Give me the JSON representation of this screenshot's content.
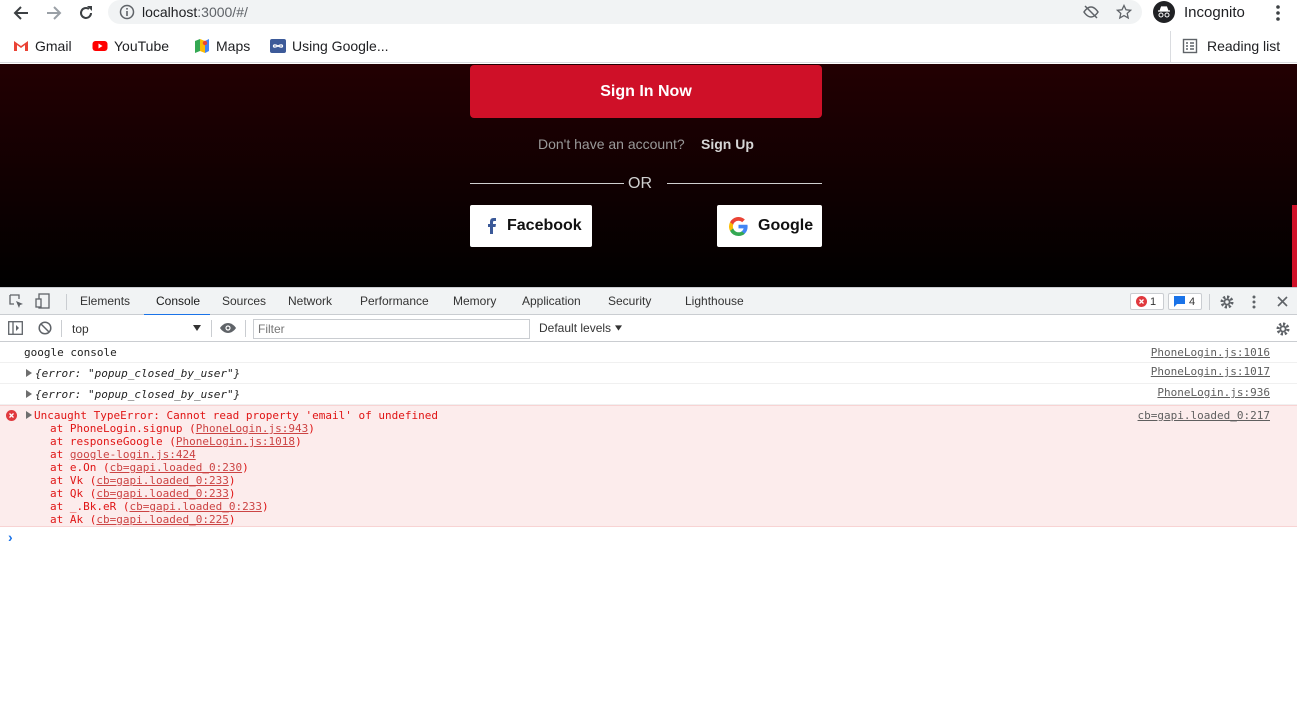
{
  "browser": {
    "url_host": "localhost",
    "url_rest": ":3000/#/",
    "profile_label": "Incognito",
    "bookmarks": [
      "Gmail",
      "YouTube",
      "Maps",
      "Using Google..."
    ],
    "reading_list": "Reading list"
  },
  "page": {
    "signin_label": "Sign In Now",
    "no_account_text": "Don't have an account?",
    "signup_label": "Sign Up",
    "or_text": "OR",
    "facebook_label": "Facebook",
    "google_label": "Google",
    "accent_color": "#cf1028"
  },
  "devtools": {
    "tabs": [
      "Elements",
      "Console",
      "Sources",
      "Network",
      "Performance",
      "Memory",
      "Application",
      "Security",
      "Lighthouse"
    ],
    "active_tab": "Console",
    "error_count": "1",
    "message_count": "4",
    "context": "top",
    "filter_placeholder": "Filter",
    "levels": "Default levels",
    "logs": [
      {
        "text": "google console",
        "source": "PhoneLogin.js:1016"
      },
      {
        "text": "{error: \"popup_closed_by_user\"}",
        "source": "PhoneLogin.js:1017"
      },
      {
        "text": "{error: \"popup_closed_by_user\"}",
        "source": "PhoneLogin.js:936"
      }
    ],
    "error": {
      "message": "Uncaught TypeError: Cannot read property 'email' of undefined",
      "source": "cb=gapi.loaded_0:217",
      "stack": [
        {
          "pre": "at PhoneLogin.signup (",
          "link": "PhoneLogin.js:943",
          "post": ")"
        },
        {
          "pre": "at responseGoogle (",
          "link": "PhoneLogin.js:1018",
          "post": ")"
        },
        {
          "pre": "at ",
          "link": "google-login.js:424",
          "post": ""
        },
        {
          "pre": "at e.On (",
          "link": "cb=gapi.loaded_0:230",
          "post": ")"
        },
        {
          "pre": "at Vk (",
          "link": "cb=gapi.loaded_0:233",
          "post": ")"
        },
        {
          "pre": "at Qk (",
          "link": "cb=gapi.loaded_0:233",
          "post": ")"
        },
        {
          "pre": "at _.Bk.eR (",
          "link": "cb=gapi.loaded_0:233",
          "post": ")"
        },
        {
          "pre": "at Ak (",
          "link": "cb=gapi.loaded_0:225",
          "post": ")"
        }
      ]
    },
    "prompt": "›"
  }
}
